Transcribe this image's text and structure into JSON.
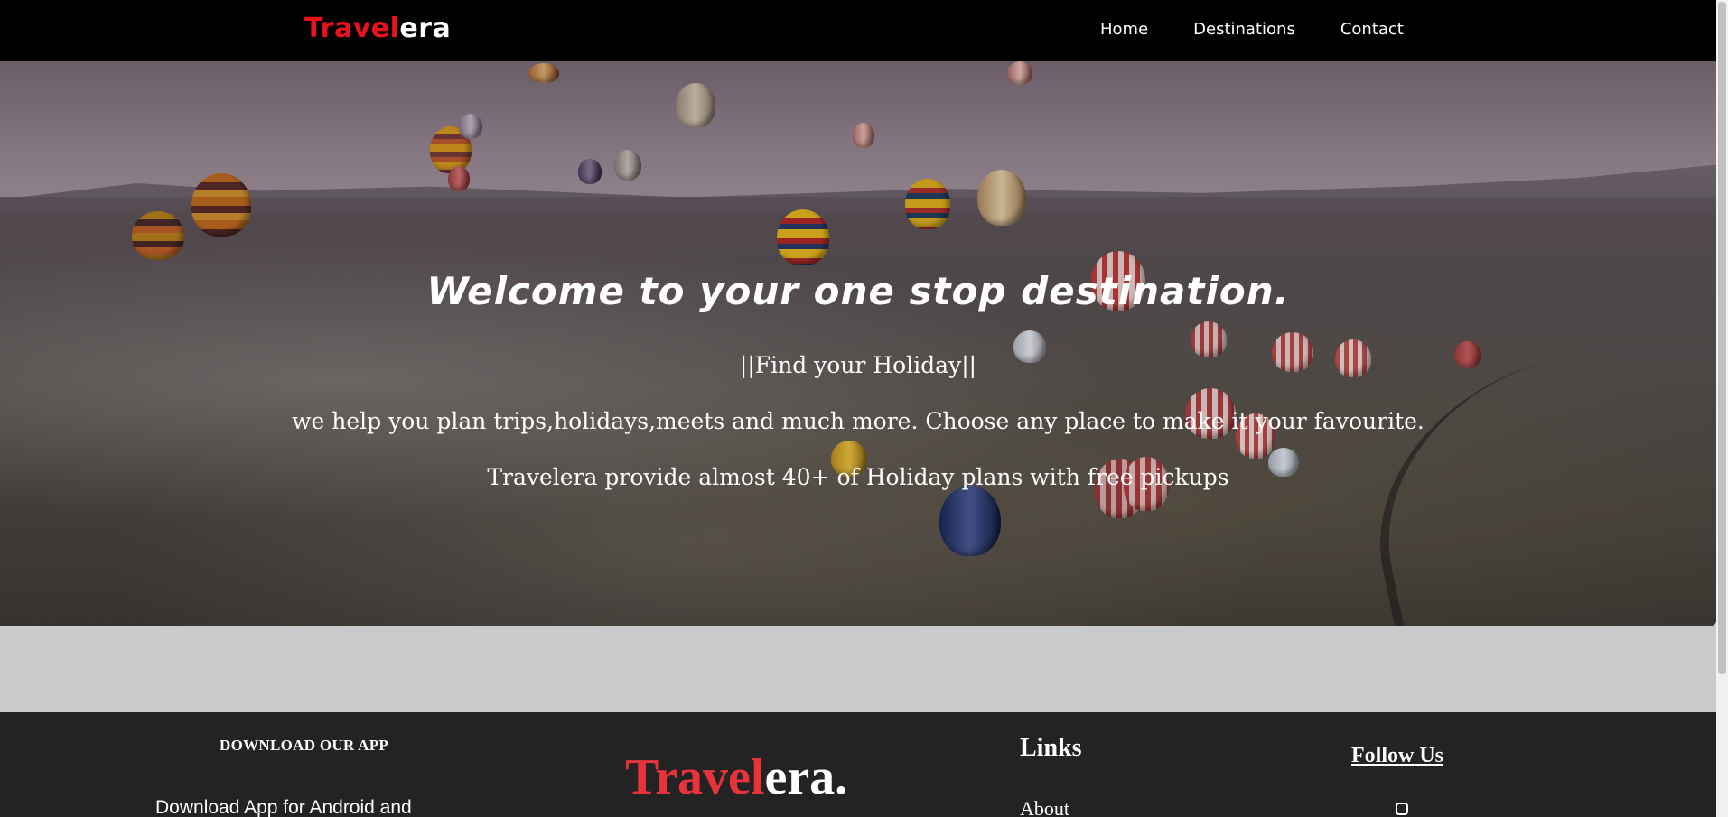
{
  "navbar": {
    "logo_red": "Travel",
    "logo_white": "era",
    "links": [
      "Home",
      "Destinations",
      "Contact"
    ]
  },
  "hero": {
    "title": "Welcome to your one stop destination.",
    "tagline": "||Find your Holiday||",
    "description": "we help you plan trips,holidays,meets and much more. Choose any place to make it your favourite.",
    "offer": "Travelera provide almost 40+ of Holiday plans with free pickups"
  },
  "footer": {
    "app_title": "DOWNLOAD OUR APP",
    "app_text": "Download App for Android and",
    "logo_red": "Travel",
    "logo_white": "era.",
    "links_title": "Links",
    "link_about": "About",
    "follow_title": "Follow Us",
    "social_icon": "instagram-icon"
  },
  "colors": {
    "navbar_bg": "#000000",
    "brand_red": "#e8131c",
    "footer_bg": "#232323",
    "page_bg": "#c9cacc"
  }
}
